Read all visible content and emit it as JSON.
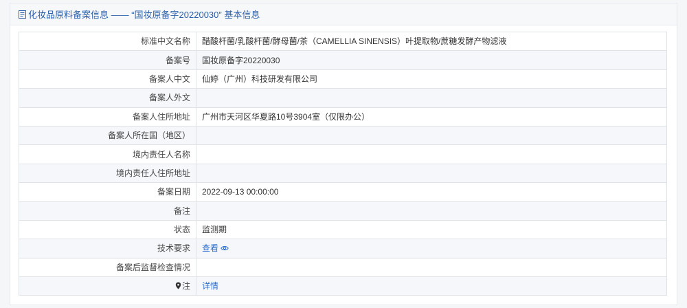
{
  "header": {
    "icon": "document-icon",
    "title": "化妆品原料备案信息 —— “国妆原备字20220030” 基本信息"
  },
  "rows": [
    {
      "label": "标准中文名称",
      "value": "醋酸杆菌/乳酸杆菌/酵母菌/茶（CAMELLIA SINENSIS）叶提取物/蔗糖发酵产物滤液"
    },
    {
      "label": "备案号",
      "value": "国妆原备字20220030"
    },
    {
      "label": "备案人中文",
      "value": "仙婷（广州）科技研发有限公司"
    },
    {
      "label": "备案人外文",
      "value": ""
    },
    {
      "label": "备案人住所地址",
      "value": "广州市天河区华夏路10号3904室（仅限办公）"
    },
    {
      "label": "备案人所在国（地区）",
      "value": ""
    },
    {
      "label": "境内责任人名称",
      "value": ""
    },
    {
      "label": "境内责任人住所地址",
      "value": ""
    },
    {
      "label": "备案日期",
      "value": "2022-09-13 00:00:00"
    },
    {
      "label": "备注",
      "value": ""
    },
    {
      "label": "状态",
      "value": "监测期"
    },
    {
      "label": "技术要求",
      "link": "查看",
      "icon": "eye-icon"
    },
    {
      "label": "备案后监督检查情况",
      "value": ""
    },
    {
      "label": "注",
      "label_icon": "marker-icon",
      "link": "详情"
    }
  ],
  "colors": {
    "title": "#2b5fa8",
    "link": "#2f6fd0",
    "border": "#dfe3e8",
    "row_alt": "#f5f7fa"
  }
}
